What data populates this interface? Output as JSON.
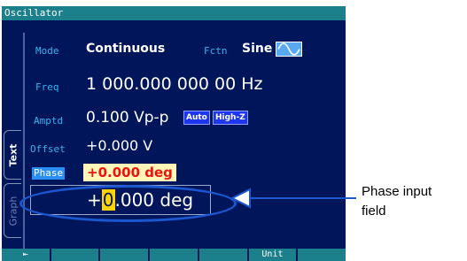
{
  "window": {
    "title": "Oscillator"
  },
  "tabs": [
    {
      "label": "Text",
      "active": true
    },
    {
      "label": "Graph",
      "active": false
    }
  ],
  "rows": {
    "mode": {
      "label": "Mode",
      "value": "Continuous"
    },
    "fctn": {
      "label": "Fctn",
      "value": "Sine",
      "icon": "sine-wave-icon"
    },
    "freq": {
      "label": "Freq",
      "value": "1 000.000 000 00 Hz"
    },
    "amptd": {
      "label": "Amptd",
      "value": "0.100 Vp-p",
      "badges": [
        "Auto",
        "High-Z"
      ]
    },
    "offset": {
      "label": "Offset",
      "value": "+0.000 V"
    },
    "phase": {
      "label": "Phase",
      "value": "+0.000 deg"
    }
  },
  "phase_input": {
    "prefix": "+",
    "cursor_digit": "0",
    "suffix": ".000 deg"
  },
  "softkeys": [
    "⇤",
    "",
    "",
    "",
    "",
    "Unit",
    ""
  ],
  "callout": {
    "line1": "Phase input",
    "line2": "field"
  },
  "colors": {
    "background": "#00155a",
    "title_bar": "#1c7f8c",
    "label": "#38b4ee",
    "highlight_ellipse": "#1b57cf",
    "cursor": "#ffd400",
    "phase_value_bg": "#fff6b8",
    "phase_value_fg": "#e8140f"
  }
}
